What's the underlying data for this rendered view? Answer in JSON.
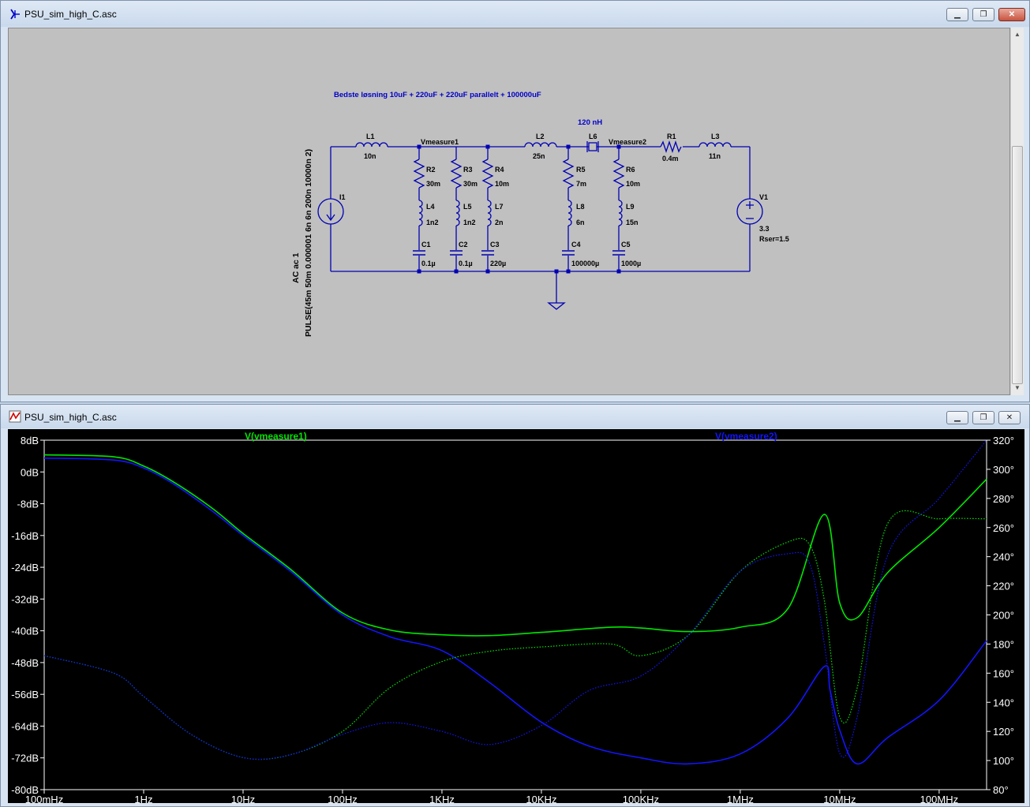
{
  "schematic_window": {
    "title": "PSU_sim_high_C.asc",
    "note": "Bedste løsning 10uF + 220uF + 220uF parallelt + 100000uF",
    "l6_note": "120 nH",
    "source_text": [
      "AC ac 1",
      "PULSE(45m 50m 0.000001 6n 6n 200n 10000n 2)"
    ],
    "nets": {
      "vmeasure1": "Vmeasure1",
      "vmeasure2": "Vmeasure2"
    },
    "components": {
      "L1": {
        "name": "L1",
        "value": "10n"
      },
      "L2": {
        "name": "L2",
        "value": "25n"
      },
      "L6": {
        "name": "L6",
        "value": ""
      },
      "R1": {
        "name": "R1",
        "value": "0.4m"
      },
      "L3": {
        "name": "L3",
        "value": "11n"
      },
      "I1": {
        "name": "I1"
      },
      "V1": {
        "name": "V1",
        "value": "3.3",
        "extra": "Rser=1.5"
      },
      "R2": {
        "name": "R2",
        "value": "30m"
      },
      "R3": {
        "name": "R3",
        "value": "30m"
      },
      "R4": {
        "name": "R4",
        "value": "10m"
      },
      "R5": {
        "name": "R5",
        "value": "7m"
      },
      "R6": {
        "name": "R6",
        "value": "10m"
      },
      "L4": {
        "name": "L4",
        "value": "1n2"
      },
      "L5": {
        "name": "L5",
        "value": "1n2"
      },
      "L7": {
        "name": "L7",
        "value": "2n"
      },
      "L8": {
        "name": "L8",
        "value": "6n"
      },
      "L9": {
        "name": "L9",
        "value": "15n"
      },
      "C1": {
        "name": "C1",
        "value": "0.1µ"
      },
      "C2": {
        "name": "C2",
        "value": "0.1µ"
      },
      "C3": {
        "name": "C3",
        "value": "220µ"
      },
      "C4": {
        "name": "C4",
        "value": "100000µ"
      },
      "C5": {
        "name": "C5",
        "value": "1000µ"
      }
    }
  },
  "plot_window": {
    "title": "PSU_sim_high_C.asc",
    "trace_labels": [
      "V(vmeasure1)",
      "V(vmeasure2)"
    ]
  },
  "window_buttons": {
    "minimize": "▁",
    "maximize": "❐",
    "close": "✕"
  },
  "colors": {
    "trace1": "#00e600",
    "trace2": "#1414ff",
    "schematic_wire": "#0000b4",
    "schematic_bg": "#c0c0c0",
    "plot_bg": "#000000",
    "axis_text": "#ffffff"
  },
  "chart_data": {
    "type": "line",
    "x_scale": "log",
    "xlim": [
      0.1,
      300000000
    ],
    "x_tick_labels": [
      "100mHz",
      "1Hz",
      "10Hz",
      "100Hz",
      "1KHz",
      "10KHz",
      "100KHz",
      "1MHz",
      "10MHz",
      "100MHz"
    ],
    "x_tick_values": [
      0.1,
      1,
      10,
      100,
      1000,
      10000,
      100000,
      1000000,
      10000000,
      100000000
    ],
    "ylim_left": [
      -80,
      8
    ],
    "y_left_tick_labels": [
      "8dB",
      "0dB",
      "-8dB",
      "-16dB",
      "-24dB",
      "-32dB",
      "-40dB",
      "-48dB",
      "-56dB",
      "-64dB",
      "-72dB",
      "-80dB"
    ],
    "y_left_tick_values": [
      8,
      0,
      -8,
      -16,
      -24,
      -32,
      -40,
      -48,
      -56,
      -64,
      -72,
      -80
    ],
    "ylim_right": [
      80,
      320
    ],
    "y_right_tick_labels": [
      "320°",
      "300°",
      "280°",
      "260°",
      "240°",
      "220°",
      "200°",
      "180°",
      "160°",
      "140°",
      "120°",
      "100°",
      "80°"
    ],
    "y_right_tick_values": [
      320,
      300,
      280,
      260,
      240,
      220,
      200,
      180,
      160,
      140,
      120,
      100,
      80
    ],
    "grid": false,
    "legend": "top",
    "series": [
      {
        "name": "V(vmeasure1)",
        "quantity": "magnitude_dB",
        "color": "#00e600",
        "style": "solid",
        "x": [
          0.1,
          0.5,
          1,
          2,
          5,
          10,
          30,
          100,
          300,
          1000,
          3000,
          10000,
          50000,
          100000,
          300000,
          1000000,
          3000000,
          7000000,
          10000000,
          15000000,
          30000000,
          100000000,
          300000000
        ],
        "y": [
          4.3,
          3.8,
          1.5,
          -2.5,
          -9.3,
          -15.5,
          -24.5,
          -35.5,
          -39.8,
          -41.0,
          -41.2,
          -40.4,
          -39.1,
          -39.3,
          -40.2,
          -39.1,
          -34.5,
          -10.7,
          -33.0,
          -36.7,
          -25.5,
          -14.0,
          -1.8
        ]
      },
      {
        "name": "V(vmeasure2)",
        "quantity": "magnitude_dB",
        "color": "#1414ff",
        "style": "solid",
        "x": [
          0.1,
          0.5,
          1,
          2,
          5,
          10,
          30,
          100,
          300,
          1000,
          3000,
          10000,
          30000,
          100000,
          300000,
          1000000,
          3000000,
          7000000,
          8000000,
          10000000,
          15000000,
          30000000,
          100000000,
          300000000
        ],
        "y": [
          3.5,
          3.0,
          1.0,
          -3.0,
          -10.0,
          -16.0,
          -25.0,
          -36.0,
          -41.5,
          -45.0,
          -53.0,
          -63.0,
          -69.0,
          -72.0,
          -73.5,
          -71.0,
          -62.0,
          -49.0,
          -55.0,
          -65.0,
          -73.5,
          -67.0,
          -57.5,
          -42.5
        ]
      },
      {
        "name": "V(vmeasure1)",
        "quantity": "phase_deg",
        "color": "#00e600",
        "style": "dotted",
        "x": [
          0.1,
          0.5,
          1,
          3,
          10,
          30,
          100,
          300,
          1000,
          3000,
          10000,
          50000,
          100000,
          300000,
          1000000,
          3000000,
          5000000,
          7000000,
          10000000,
          15000000,
          30000000,
          100000000,
          300000000
        ],
        "y": [
          172,
          160,
          144,
          118,
          102,
          104,
          120,
          150,
          168,
          175,
          178,
          180,
          172,
          186,
          230,
          250,
          248,
          210,
          130,
          150,
          262,
          266,
          266
        ]
      },
      {
        "name": "V(vmeasure2)",
        "quantity": "phase_deg",
        "color": "#1414ff",
        "style": "dotted",
        "x": [
          0.1,
          0.5,
          1,
          3,
          10,
          30,
          100,
          300,
          1000,
          3000,
          10000,
          30000,
          100000,
          300000,
          1000000,
          3000000,
          5000000,
          7000000,
          10000000,
          15000000,
          30000000,
          100000000,
          300000000
        ],
        "y": [
          172,
          160,
          144,
          118,
          102,
          104,
          118,
          126,
          120,
          111,
          124,
          148,
          158,
          186,
          230,
          242,
          235,
          180,
          105,
          130,
          240,
          280,
          320
        ]
      }
    ]
  }
}
